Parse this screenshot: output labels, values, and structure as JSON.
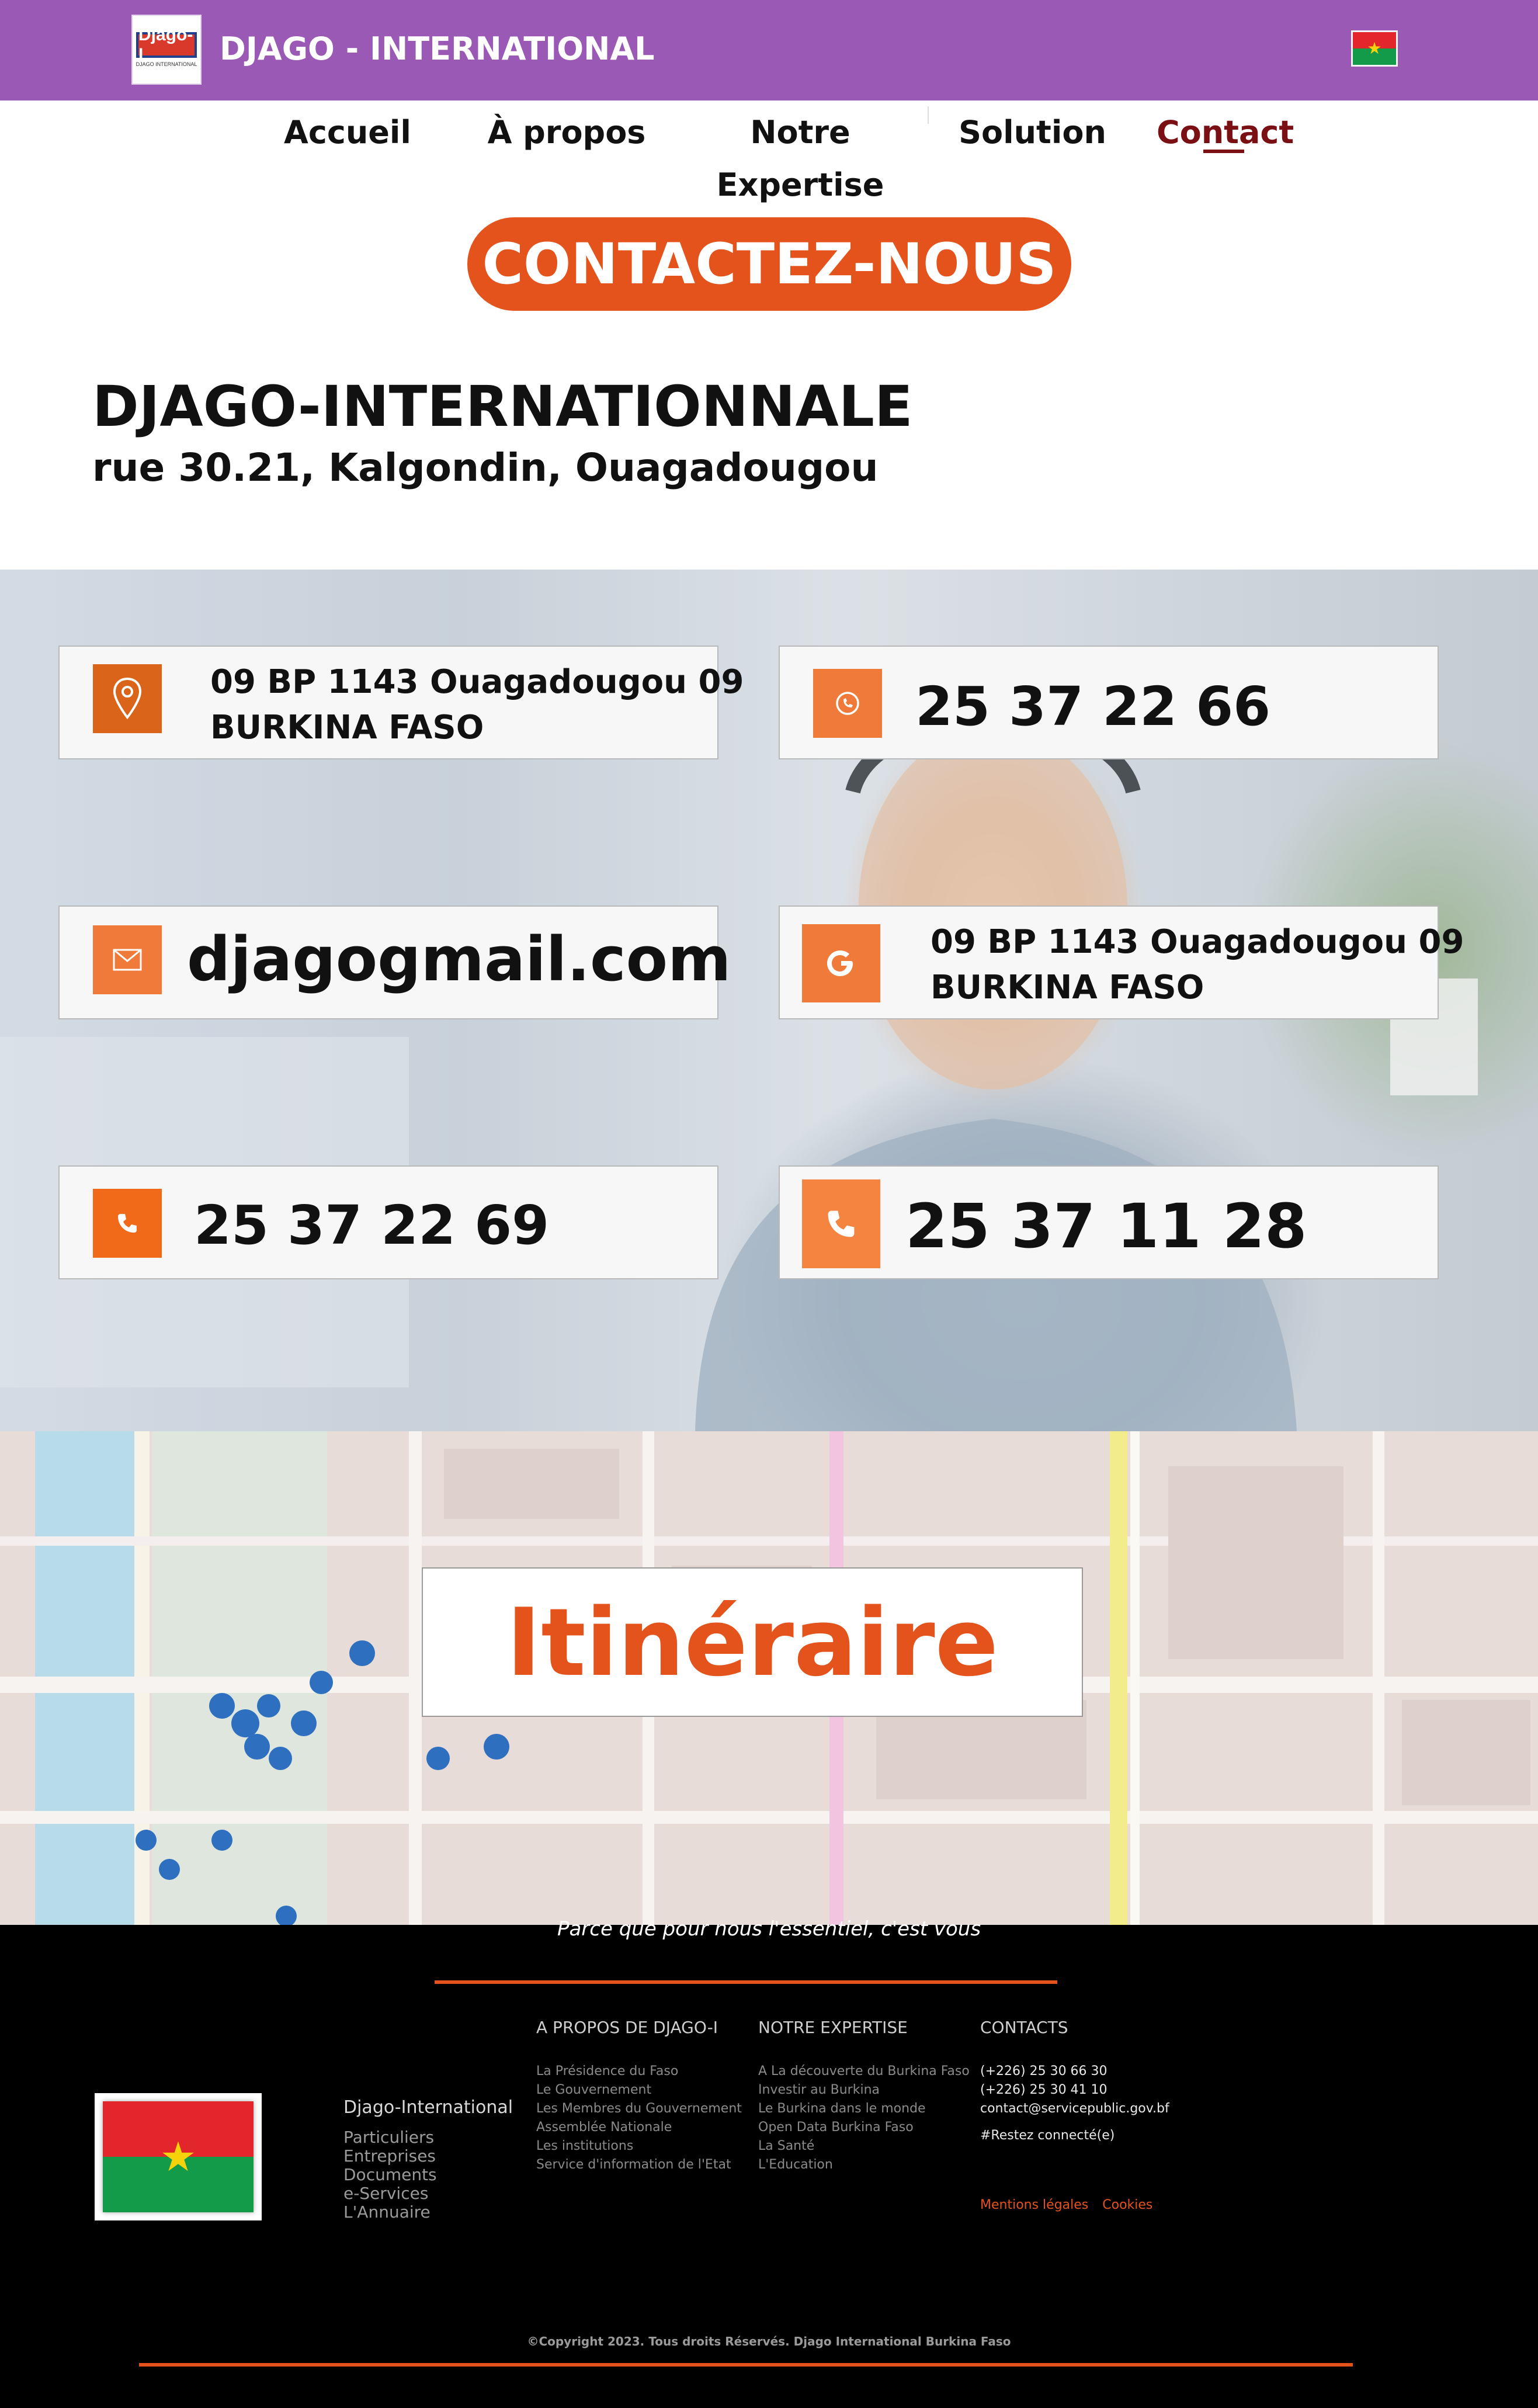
{
  "header": {
    "logo_text": "Djago-I",
    "logo_subtext": "DJAGO INTERNATIONAL",
    "brand": "DJAGO - INTERNATIONAL"
  },
  "nav": {
    "items": [
      {
        "label": "Accueil"
      },
      {
        "label": "À propos"
      },
      {
        "label": "Notre Expertise"
      },
      {
        "label": "Solution"
      },
      {
        "label": "Contact",
        "active": true
      }
    ]
  },
  "contact": {
    "button_label": "CONTACTEZ-NOUS",
    "company": "DJAGO-INTERNATIONNALE",
    "address": "rue 30.21, Kalgondin, Ouagadougou"
  },
  "cards": [
    {
      "icon": "map-pin-icon",
      "line1": "09 BP 1143 Ouagadougou 09",
      "line2": "BURKINA FASO"
    },
    {
      "icon": "whatsapp-icon",
      "text": "25 37 22 66"
    },
    {
      "icon": "mail-icon",
      "text": "djagogmail.com"
    },
    {
      "icon": "google-icon",
      "line1": "09 BP 1143 Ouagadougou 09",
      "line2": "BURKINA FASO"
    },
    {
      "icon": "phone-icon",
      "text": "25 37 22 69"
    },
    {
      "icon": "phone-icon",
      "text": "25 37 11 28"
    }
  ],
  "map": {
    "button_label": "Itinéraire"
  },
  "footer": {
    "slogan": "Parce que pour nous l'essentiel, c'est vous",
    "brand_title": "Djago-International",
    "brand_links": [
      "Particuliers",
      "Entreprises",
      "Documents",
      "e-Services",
      "L'Annuaire"
    ],
    "about_title": "A PROPOS DE DJAGO-I",
    "about_links": [
      "La Présidence du Faso",
      "Le Gouvernement",
      "Les Membres du Gouvernement",
      "Assemblée Nationale",
      "Les institutions",
      "Service d'information de l'Etat"
    ],
    "expertise_title": "NOTRE EXPERTISE",
    "expertise_links": [
      "A La découverte du Burkina Faso",
      "Investir au Burkina",
      "Le Burkina dans le monde",
      "Open Data Burkina Faso",
      "La Santé",
      "L'Education"
    ],
    "contacts_title": "CONTACTS",
    "contacts_lines": [
      "(+226) 25 30 66 30",
      "(+226) 25 30 41 10",
      "contact@servicepublic.gov.bf"
    ],
    "social": "#Restez connecté(e)",
    "legal_links": [
      "Mentions légales",
      "Cookies"
    ],
    "copyright": "©Copyright 2023. Tous droits Réservés. Djago International Burkina Faso"
  },
  "colors": {
    "topbar": "#9b59b6",
    "accent": "#e4531b",
    "active_nav": "#7a0f14",
    "footer_bg": "#000000"
  }
}
